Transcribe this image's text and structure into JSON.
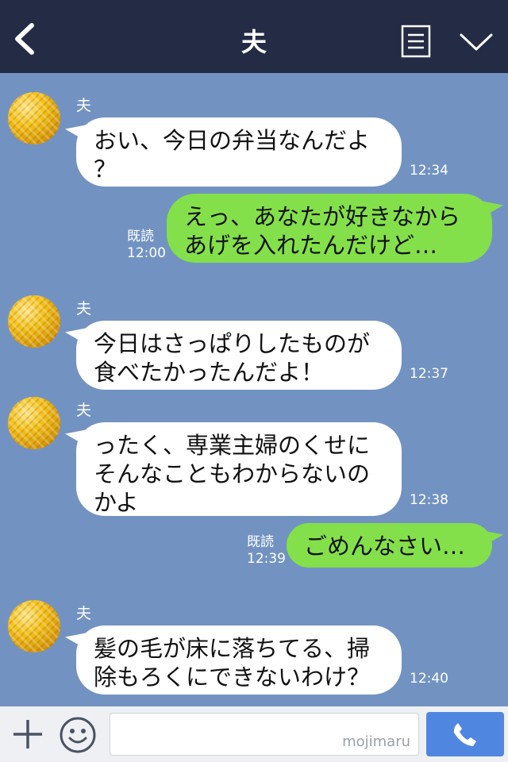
{
  "header": {
    "title": "夫"
  },
  "messages": [
    {
      "sender": "夫",
      "lines": [
        "おい、今日の弁当なんだよ",
        "？"
      ],
      "time": "12:34"
    },
    {
      "lines": [
        "えっ、あなたが好きなから",
        "あげを入れたんだけど…"
      ],
      "read": "既読",
      "time": "12:00"
    },
    {
      "sender": "夫",
      "lines": [
        "今日はさっぱりしたものが",
        "食べたかったんだよ！"
      ],
      "time": "12:37"
    },
    {
      "sender": "夫",
      "lines": [
        "ったく、専業主婦のくせに",
        "そんなこともわからないの",
        "かよ"
      ],
      "time": "12:38"
    },
    {
      "lines": [
        "ごめんなさい…"
      ],
      "read": "既読",
      "time": "12:39"
    },
    {
      "sender": "夫",
      "lines": [
        "髪の毛が床に落ちてる、掃",
        "除もろくにできないわけ？"
      ],
      "time": "12:40"
    }
  ],
  "footer": {
    "input_watermark": "mojimaru"
  },
  "icons": {
    "back": "chevron-left-icon",
    "menu": "list-icon",
    "collapse": "chevron-down-icon",
    "add": "plus-icon",
    "emoji": "smile-icon",
    "call": "phone-icon"
  },
  "colors": {
    "header_bg": "#232b45",
    "chat_bg": "#7293c2",
    "outgoing_bubble": "#84e04a",
    "incoming_bubble": "#ffffff",
    "call_button": "#4f86e0"
  }
}
